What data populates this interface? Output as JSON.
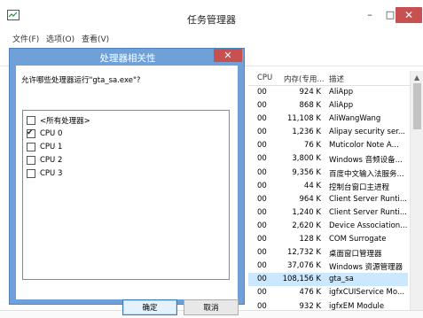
{
  "window": {
    "title": "任务管理器",
    "min_glyph": "–",
    "max_glyph": "□",
    "close_glyph": "✕"
  },
  "menu": [
    {
      "label": "文件(F)"
    },
    {
      "label": "选项(O)"
    },
    {
      "label": "查看(V)"
    }
  ],
  "table": {
    "columns": {
      "cpu": "CPU",
      "mem": "内存(专用...",
      "desc": "描述",
      "sort": "^"
    },
    "rows": [
      {
        "cpu": "00",
        "mem": "924 K",
        "desc": "AliApp"
      },
      {
        "cpu": "00",
        "mem": "868 K",
        "desc": "AliApp"
      },
      {
        "cpu": "00",
        "mem": "11,108 K",
        "desc": "AliWangWang"
      },
      {
        "cpu": "00",
        "mem": "1,236 K",
        "desc": "Alipay security ser..."
      },
      {
        "cpu": "00",
        "mem": "76 K",
        "desc": "Muticolor Note A..."
      },
      {
        "cpu": "00",
        "mem": "3,800 K",
        "desc": "Windows 音频设备..."
      },
      {
        "cpu": "00",
        "mem": "9,356 K",
        "desc": "百度中文输入法服务..."
      },
      {
        "cpu": "00",
        "mem": "44 K",
        "desc": "控制台窗口主进程"
      },
      {
        "cpu": "00",
        "mem": "964 K",
        "desc": "Client Server Runti..."
      },
      {
        "cpu": "00",
        "mem": "1,240 K",
        "desc": "Client Server Runti..."
      },
      {
        "cpu": "00",
        "mem": "2,620 K",
        "desc": "Device Association..."
      },
      {
        "cpu": "00",
        "mem": "128 K",
        "desc": "COM Surrogate"
      },
      {
        "cpu": "00",
        "mem": "12,732 K",
        "desc": "桌面窗口管理器"
      },
      {
        "cpu": "00",
        "mem": "37,076 K",
        "desc": "Windows 资源管理器"
      },
      {
        "cpu": "00",
        "mem": "108,156 K",
        "desc": "gta_sa"
      },
      {
        "cpu": "00",
        "mem": "476 K",
        "desc": "igfxCUIService Mo..."
      },
      {
        "cpu": "00",
        "mem": "932 K",
        "desc": "igfxEM Module"
      }
    ]
  },
  "dialog": {
    "title": "处理器相关性",
    "close_glyph": "✕",
    "prompt": "允许哪些处理器运行\"gta_sa.exe\"?",
    "options": [
      {
        "label": "<所有处理器>",
        "checked": false
      },
      {
        "label": "CPU 0",
        "checked": true
      },
      {
        "label": "CPU 1",
        "checked": false
      },
      {
        "label": "CPU 2",
        "checked": false
      },
      {
        "label": "CPU 3",
        "checked": false
      }
    ],
    "ok_label": "确定",
    "cancel_label": "取消"
  },
  "colors": {
    "dialog_frame": "#6fa1d8",
    "close_red": "#c75050",
    "selected_row": "#cce8ff"
  },
  "icons": {
    "app": "task-manager-icon",
    "checkbox_mark": "check-icon"
  }
}
